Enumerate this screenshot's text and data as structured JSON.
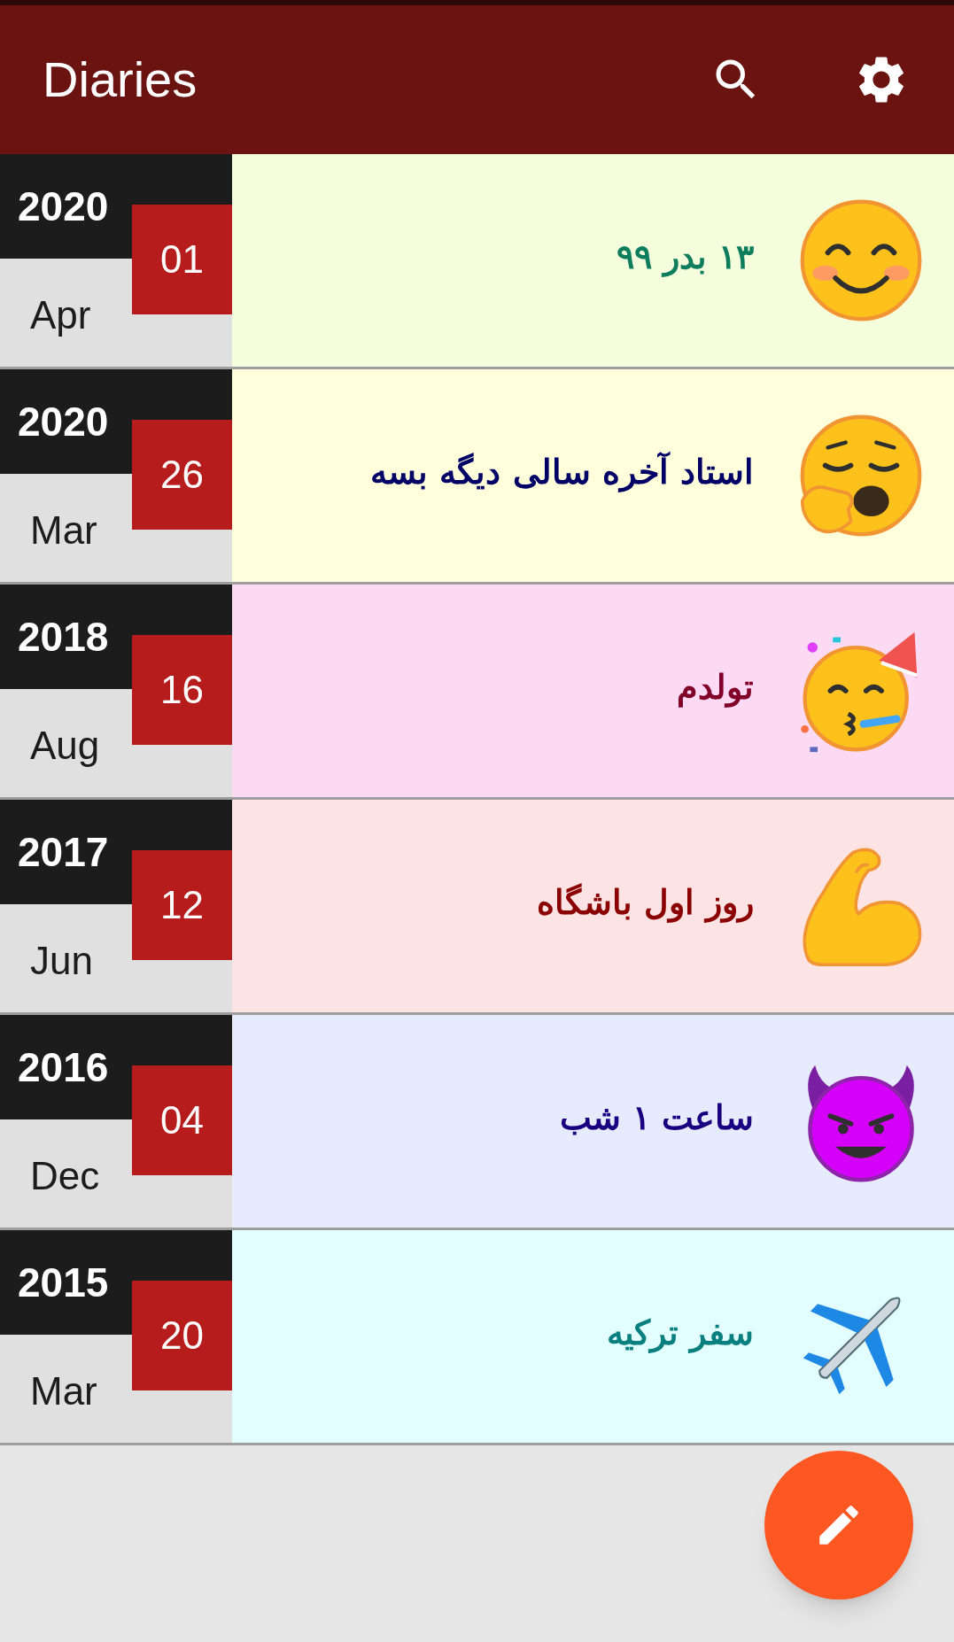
{
  "app_bar": {
    "title": "Diaries"
  },
  "entries": [
    {
      "year": "2020",
      "day": "01",
      "month": "Apr",
      "title": {
        "text": "۱۳ بدر ۹۹",
        "color": "#0e7d5d"
      },
      "color": "#f5fedc",
      "kind": "smile"
    },
    {
      "year": "2020",
      "day": "26",
      "month": "Mar",
      "title": {
        "text": "استاد آخره سالی دیگه بسه",
        "color": "#000066"
      },
      "color": "#ffffdc",
      "kind": "yawn"
    },
    {
      "year": "2018",
      "day": "16",
      "month": "Aug",
      "title": {
        "text": "تولدم",
        "color": "#80002a"
      },
      "color": "#fddaf3",
      "kind": "party"
    },
    {
      "year": "2017",
      "day": "12",
      "month": "Jun",
      "title": {
        "text": "روز اول باشگاه",
        "color": "#8b0000"
      },
      "color": "#fee3e4",
      "kind": "muscle"
    },
    {
      "year": "2016",
      "day": "04",
      "month": "Dec",
      "title": {
        "text": "ساعت ۱ شب",
        "color": "#1a0080"
      },
      "color": "#e6ebfe",
      "kind": "devil"
    },
    {
      "year": "2015",
      "day": "20",
      "month": "Mar",
      "title": {
        "text": "سفر ترکیه",
        "color": "#0a7f7f"
      },
      "color": "#e2fefe",
      "kind": "airplane"
    }
  ]
}
